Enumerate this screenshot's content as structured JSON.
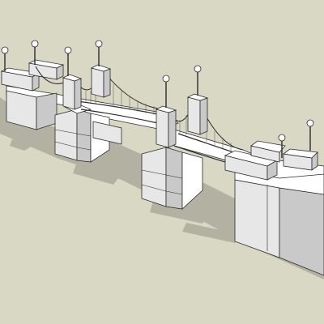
{
  "scene": {
    "subject": "bridge-3d-model",
    "colors": {
      "background": "#d9d8c4",
      "shadow": "#b3b2a2",
      "face_light": "#ffffff",
      "face_mid": "#e7e7e7",
      "face_dark": "#c9c9c9",
      "edge": "#2b2b2b",
      "cable": "#555555"
    }
  }
}
